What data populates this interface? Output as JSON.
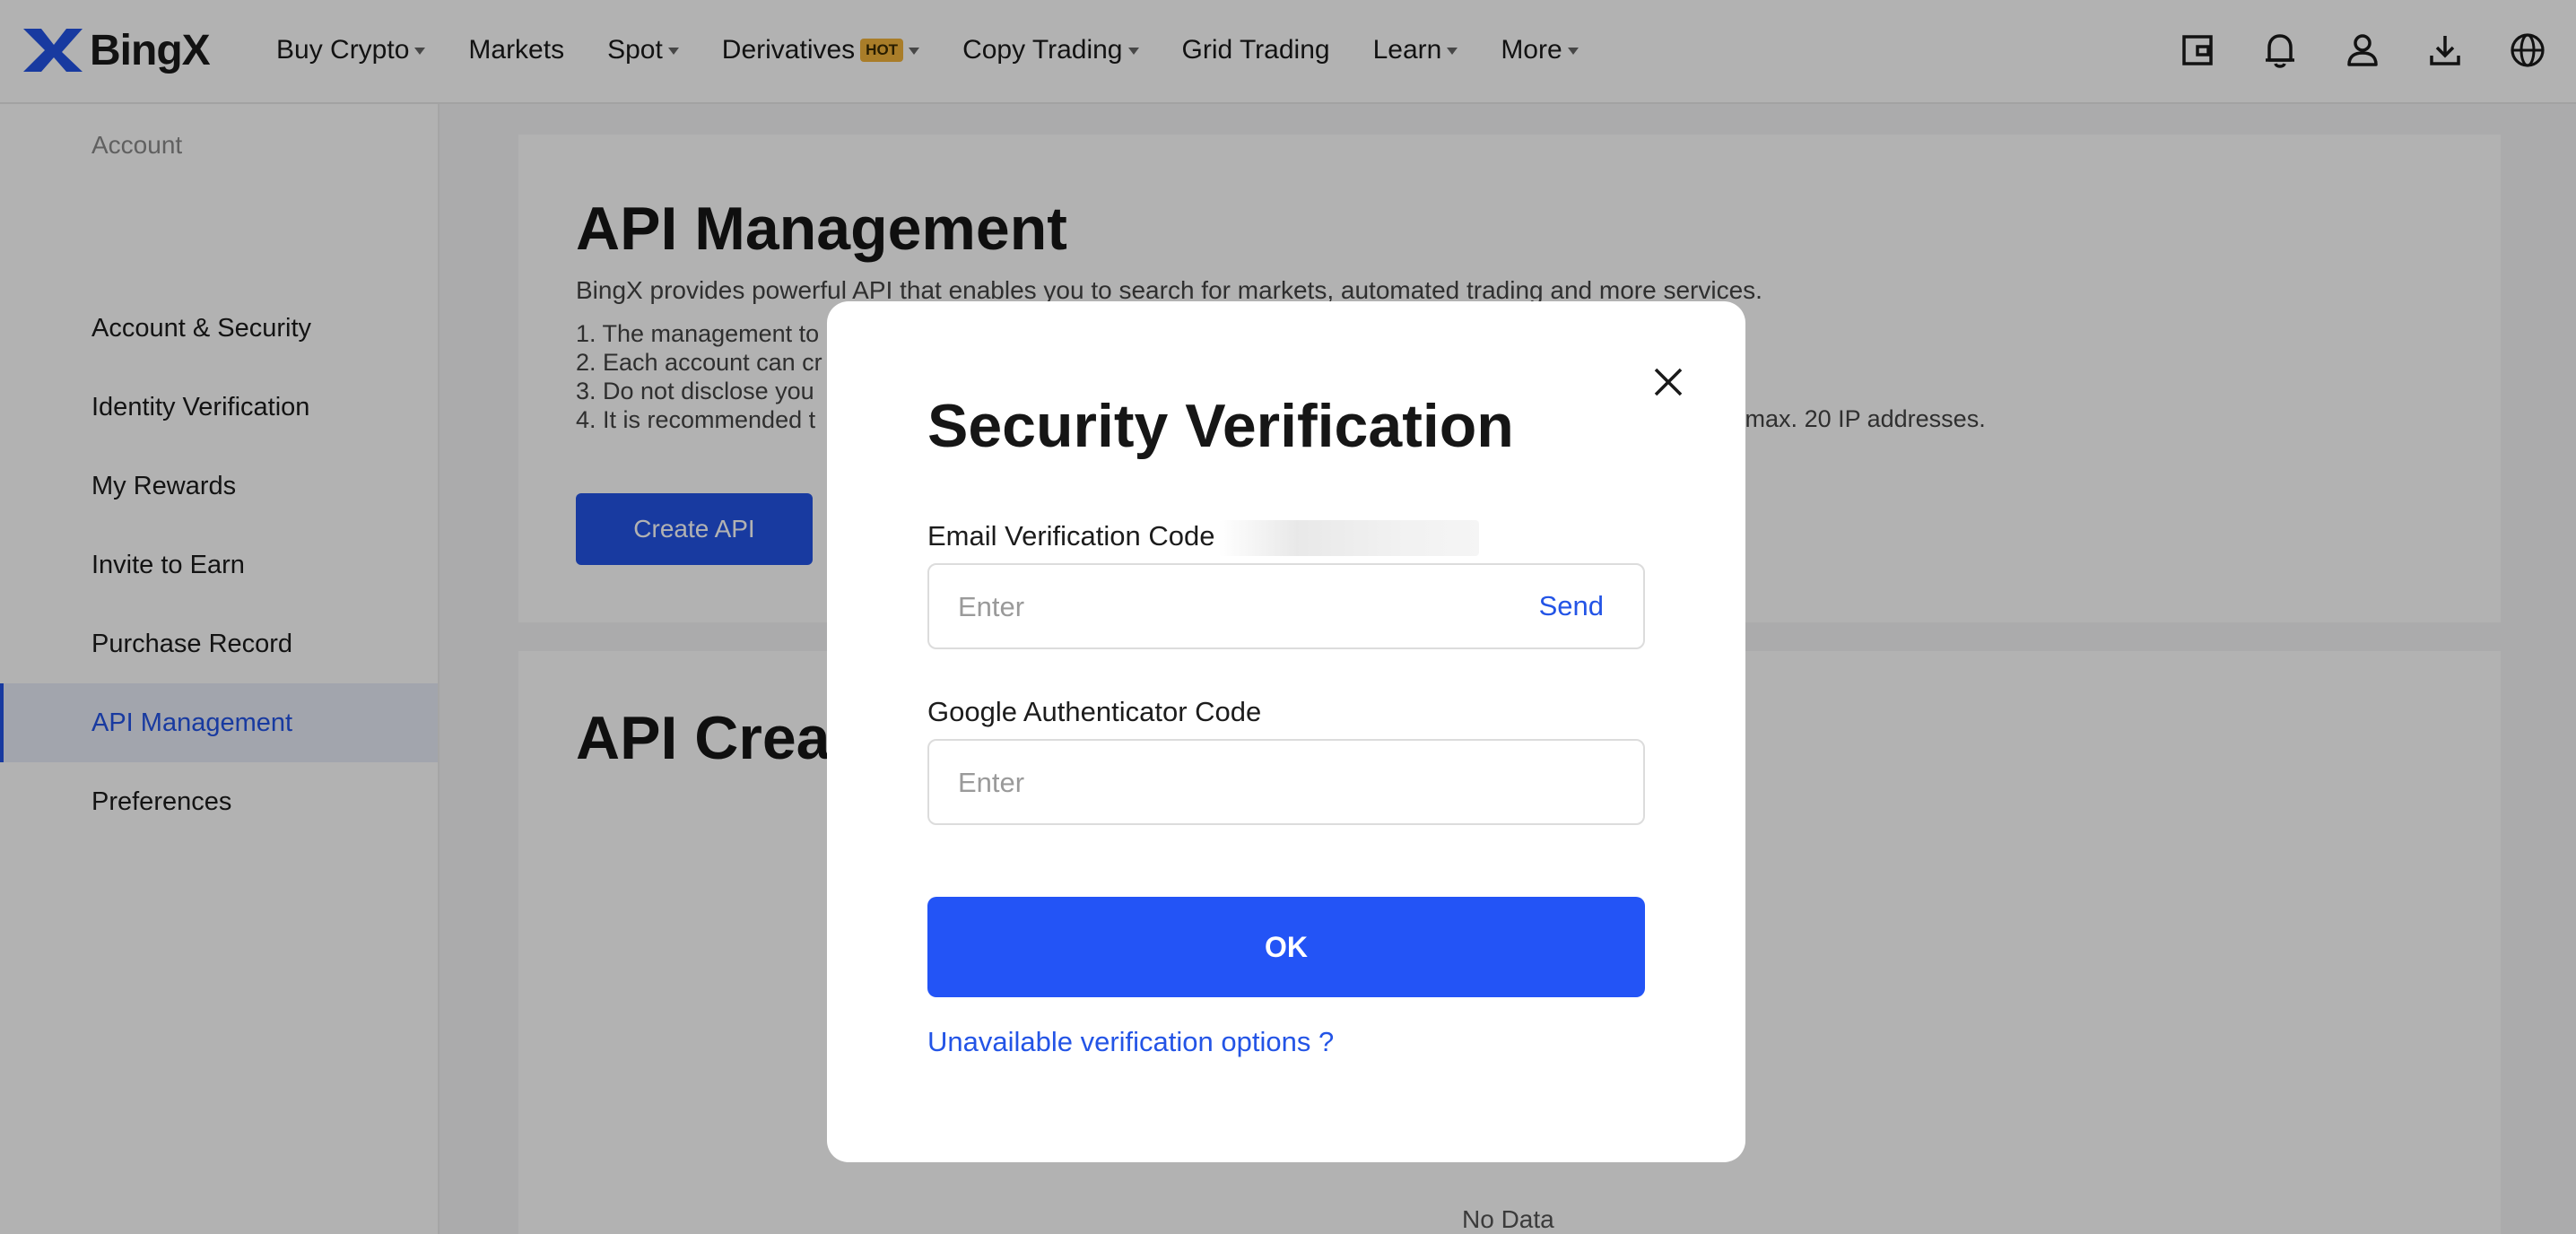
{
  "header": {
    "logo_text": "BingX",
    "nav": [
      {
        "label": "Buy Crypto",
        "has_caret": true
      },
      {
        "label": "Markets",
        "has_caret": false
      },
      {
        "label": "Spot",
        "has_caret": true
      },
      {
        "label": "Derivatives",
        "badge": "HOT",
        "has_caret": true
      },
      {
        "label": "Copy Trading",
        "has_caret": true
      },
      {
        "label": "Grid Trading",
        "has_caret": false
      },
      {
        "label": "Learn",
        "has_caret": true
      },
      {
        "label": "More",
        "has_caret": true
      }
    ],
    "icons": [
      "wallet-icon",
      "bell-icon",
      "user-icon",
      "download-icon",
      "globe-icon"
    ]
  },
  "sidebar": {
    "heading": "Account",
    "items": [
      {
        "label": "Account & Security",
        "active": false
      },
      {
        "label": "Identity Verification",
        "active": false
      },
      {
        "label": "My Rewards",
        "active": false
      },
      {
        "label": "Invite to Earn",
        "active": false
      },
      {
        "label": "Purchase Record",
        "active": false
      },
      {
        "label": "API Management",
        "active": true
      },
      {
        "label": "Preferences",
        "active": false
      }
    ]
  },
  "main": {
    "title": "API Management",
    "intro": "BingX provides powerful API that enables you to search for markets, automated trading and more services.",
    "rules": [
      "1. The management to",
      "2. Each account can cr",
      "3. Do not disclose you",
      "4. It is recommended t"
    ],
    "rule4_tail": "nd to max. 20 IP addresses.",
    "create_button": "Create API",
    "section2_title": "API Creat",
    "no_data": "No Data"
  },
  "modal": {
    "title": "Security Verification",
    "email_label": "Email Verification Code",
    "email_placeholder": "Enter",
    "send_label": "Send",
    "google_label": "Google Authenticator Code",
    "google_placeholder": "Enter",
    "ok_label": "OK",
    "unavailable_link": "Unavailable verification options ?"
  },
  "colors": {
    "brand_blue": "#2354E6",
    "button_blue": "#2354F6",
    "hot_badge": "#F2B33C"
  }
}
